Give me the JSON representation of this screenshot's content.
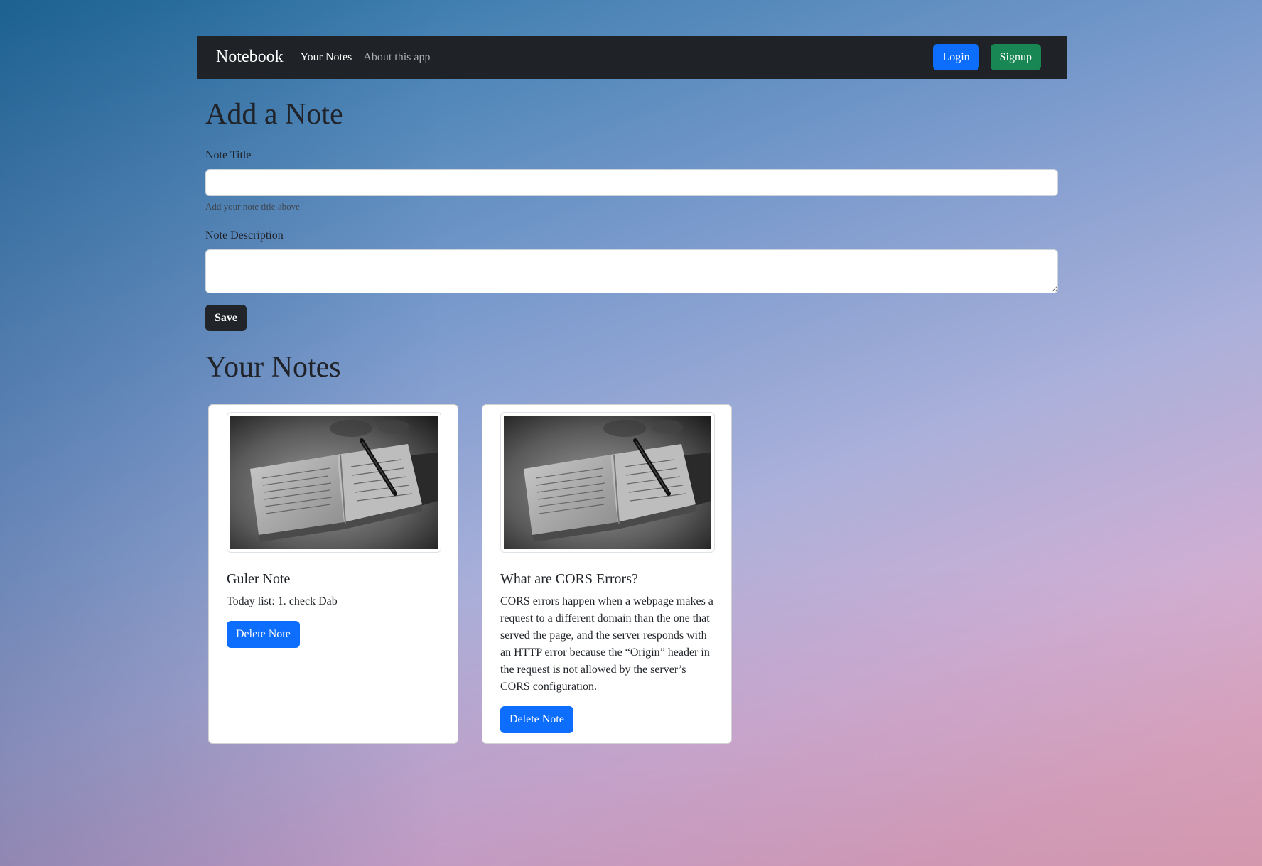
{
  "navbar": {
    "brand": "Notebook",
    "links": [
      {
        "label": "Your Notes"
      },
      {
        "label": "About this app"
      }
    ],
    "login_label": "Login",
    "signup_label": "Signup"
  },
  "add_note": {
    "heading": "Add a Note",
    "title_label": "Note Title",
    "title_value": "",
    "title_help": "Add your note title above",
    "description_label": "Note Description",
    "description_value": "",
    "save_label": "Save"
  },
  "notes_section": {
    "heading": "Your Notes",
    "notes": [
      {
        "title": "Guler Note",
        "description": "Today list: 1. check Dab",
        "delete_label": "Delete Note",
        "image_icon": "notebook-photo"
      },
      {
        "title": "What are CORS Errors?",
        "description": "CORS errors happen when a webpage makes a request to a different domain than the one that served the page, and the server responds with an HTTP error because the “Origin” header in the request is not allowed by the server’s CORS configuration.",
        "delete_label": "Delete Note",
        "image_icon": "notebook-photo"
      }
    ]
  },
  "colors": {
    "navbar_bg": "#1f2226",
    "primary": "#0d6efd",
    "success": "#198754",
    "dark": "#212529"
  }
}
